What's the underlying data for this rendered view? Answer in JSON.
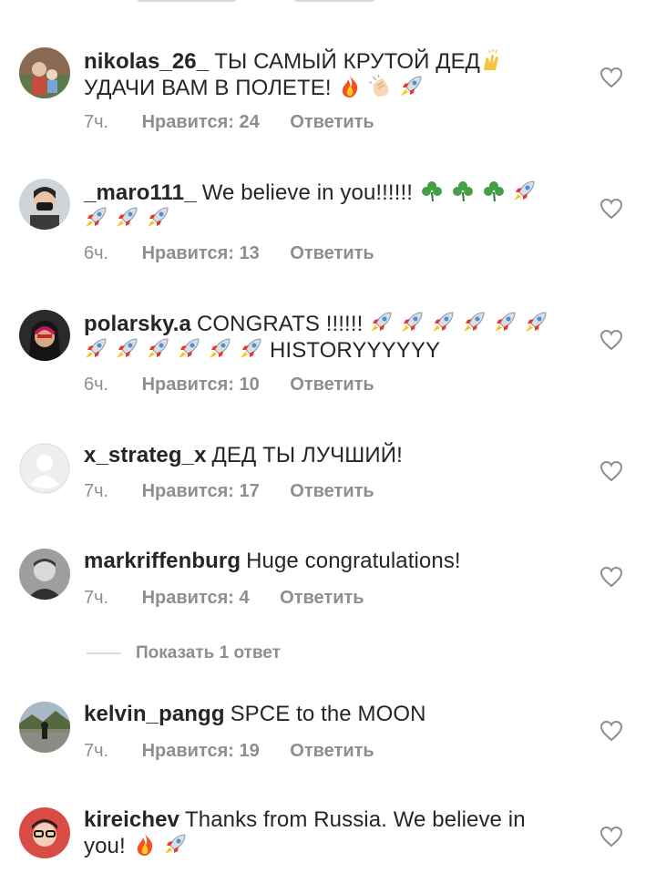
{
  "colors": {
    "text": "#262626",
    "secondary": "#8e8e8e",
    "separator": "#dbdbdb",
    "background": "#ffffff"
  },
  "comments": [
    {
      "username": "nikolas_26_",
      "text_line1": "ТЫ САМЫЙ КРУТОЙ ДЕД",
      "text_line2": "УДАЧИ ВАМ В ПОЛЕТЕ!",
      "emoji": [
        "raising-hands",
        "fire",
        "clapping-hands",
        "rocket"
      ],
      "time": "7ч.",
      "likes": "Нравится: 24",
      "reply": "Ответить"
    },
    {
      "username": "_maro111_",
      "text_line1": "We believe in you!!!!!!",
      "emoji": [
        "shamrock",
        "shamrock",
        "shamrock",
        "rocket",
        "rocket",
        "rocket",
        "rocket"
      ],
      "time": "6ч.",
      "likes": "Нравится: 13",
      "reply": "Ответить"
    },
    {
      "username": "polarsky.a",
      "text_line1": "CONGRATS !!!!!!",
      "text_tail": "HISTORYYYYYY",
      "emoji": [
        "rocket",
        "rocket",
        "rocket",
        "rocket",
        "rocket",
        "rocket",
        "rocket",
        "rocket",
        "rocket",
        "rocket",
        "rocket",
        "rocket"
      ],
      "time": "6ч.",
      "likes": "Нравится: 10",
      "reply": "Ответить"
    },
    {
      "username": "x_strateg_x",
      "text_line1": "ДЕД ТЫ ЛУЧШИЙ!",
      "time": "7ч.",
      "likes": "Нравится: 17",
      "reply": "Ответить"
    },
    {
      "username": "markriffenburg",
      "text_line1": "Huge congratulations!",
      "time": "7ч.",
      "likes": "Нравится: 4",
      "reply": "Ответить",
      "show_replies": "Показать 1 ответ"
    },
    {
      "username": "kelvin_pangg",
      "text_line1": "SPCE to the MOON",
      "time": "7ч.",
      "likes": "Нравится: 19",
      "reply": "Ответить"
    },
    {
      "username": "kireichev",
      "text_line1": "Thanks from Russia. We believe in",
      "text_line2": "you!",
      "emoji": [
        "fire",
        "rocket"
      ]
    }
  ]
}
